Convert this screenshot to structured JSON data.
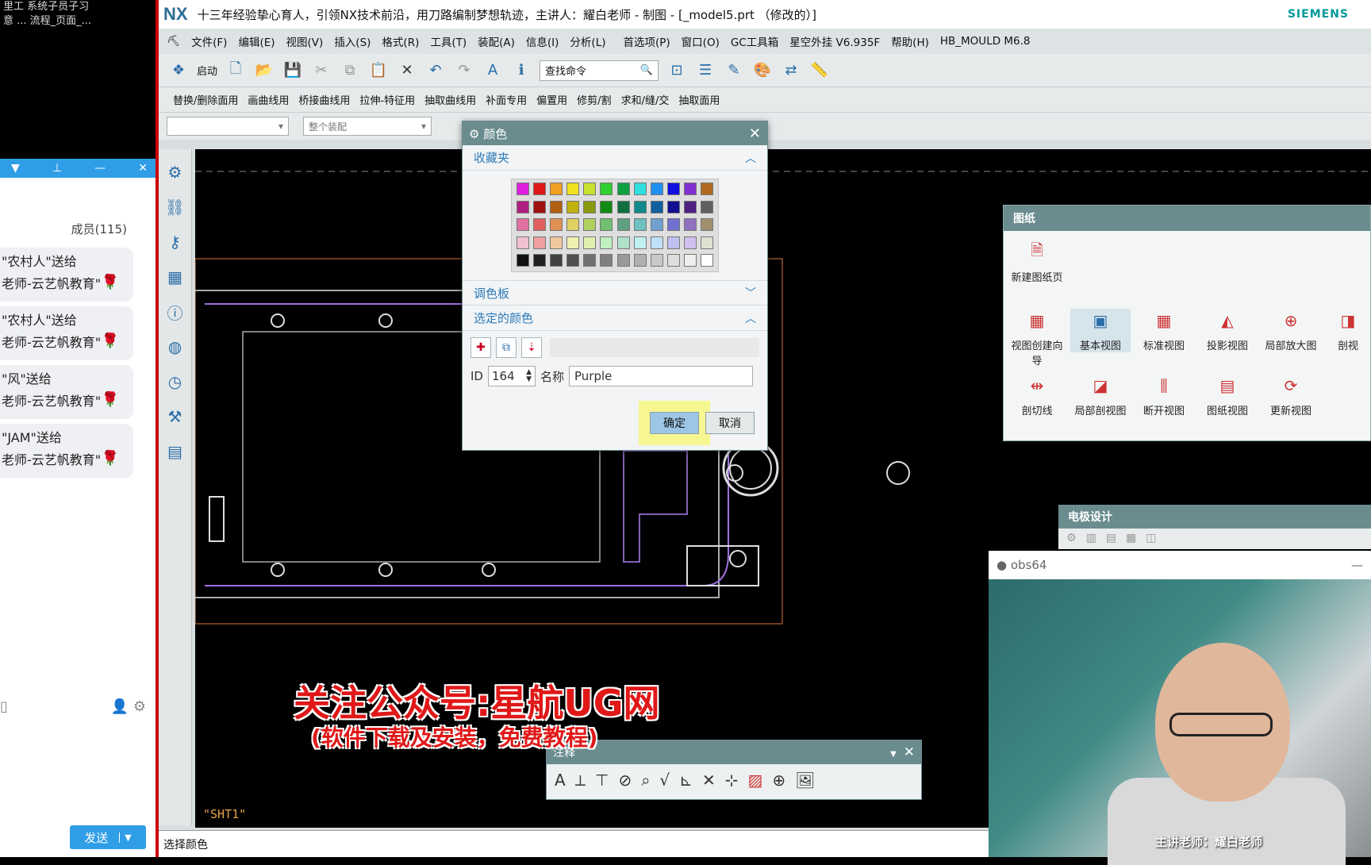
{
  "chat": {
    "top_lines": [
      "里工   系统子员子习",
      "意 ...   流程_页面_..."
    ],
    "members": "成员(115)",
    "messages": [
      {
        "line1": "\"农村人\"送给",
        "line2": "老师-云艺帆教育\""
      },
      {
        "line1": "\"农村人\"送给",
        "line2": "老师-云艺帆教育\""
      },
      {
        "line1": "\"风\"送给",
        "line2": "老师-云艺帆教育\""
      },
      {
        "line1": "\"JAM\"送给",
        "line2": "老师-云艺帆教育\""
      }
    ],
    "send_label": "发送"
  },
  "nx": {
    "logo": "NX",
    "title": "十三年经验挚心育人，引领NX技术前沿，用刀路编制梦想轨迹，主讲人：耀白老师 - 制图 - [_model5.prt （修改的）]",
    "brand": "SIEMENS",
    "menu": [
      "文件(F)",
      "编辑(E)",
      "视图(V)",
      "插入(S)",
      "格式(R)",
      "工具(T)",
      "装配(A)",
      "信息(I)",
      "分析(L)",
      "首选项(P)",
      "窗口(O)",
      "GC工具箱",
      "星空外挂 V6.935F",
      "帮助(H)",
      "HB_MOULD M6.8"
    ],
    "start_label": "启动",
    "search_placeholder": "查找命令",
    "toolbar2": [
      "替换/删除面用",
      "画曲线用",
      "桥接曲线用",
      "拉伸-特征用",
      "抽取曲线用",
      "补面专用",
      "偏置用",
      "修剪/割",
      "求和/缝/交",
      "抽取面用"
    ],
    "filter_assembly": "整个装配",
    "sheet_label": "\"SHT1\"",
    "status": "选择颜色"
  },
  "color_dialog": {
    "title": "颜色",
    "favorites": "收藏夹",
    "palette_section": "调色板",
    "selected_section": "选定的颜色",
    "id_label": "ID",
    "id_value": "164",
    "name_label": "名称",
    "name_value": "Purple",
    "ok": "确定",
    "cancel": "取消",
    "swatches": [
      "#e020e0",
      "#e01818",
      "#f0a020",
      "#f0e020",
      "#c8e030",
      "#30d030",
      "#10a040",
      "#30e0e0",
      "#2090f0",
      "#1010e0",
      "#8030d0",
      "#b06a20",
      "#b02080",
      "#a01010",
      "#b06010",
      "#c0b010",
      "#8a9a10",
      "#108a10",
      "#107040",
      "#108a8a",
      "#1060a0",
      "#101090",
      "#502080",
      "#606060",
      "#e070a0",
      "#e06060",
      "#e09050",
      "#e0d060",
      "#b0d060",
      "#70c070",
      "#60a080",
      "#70c0c0",
      "#70a0d0",
      "#7070d0",
      "#9070c0",
      "#a09070",
      "#f0c0d0",
      "#f0a0a0",
      "#f0c8a0",
      "#f0f0b0",
      "#e0f0b0",
      "#c0f0c0",
      "#b0e0c8",
      "#c0f0f0",
      "#c0e0f8",
      "#c0c0f0",
      "#d0c0f0",
      "#e0e0d0",
      "#101010",
      "#202020",
      "#404040",
      "#505050",
      "#707070",
      "#808080",
      "#999999",
      "#b0b0b0",
      "#c8c8c8",
      "#dddddd",
      "#eeeeee",
      "#ffffff"
    ]
  },
  "drawing_panel": {
    "title": "图纸",
    "new_sheet": "新建图纸页",
    "items_row1": [
      "视图创建向导",
      "基本视图",
      "标准视图",
      "投影视图",
      "局部放大图",
      "剖视"
    ],
    "items_row2": [
      "剖切线",
      "局部剖视图",
      "断开视图",
      "图纸视图",
      "更新视图"
    ]
  },
  "electrode_panel": {
    "title": "电极设计"
  },
  "annotation_bar": {
    "title": "注释"
  },
  "webcam": {
    "title": "obs64",
    "caption": "主讲老师：耀白老师"
  },
  "watermark": {
    "line1": "关注公众号:星航UG网",
    "line2": "(软件下载及安装，免费教程)"
  }
}
